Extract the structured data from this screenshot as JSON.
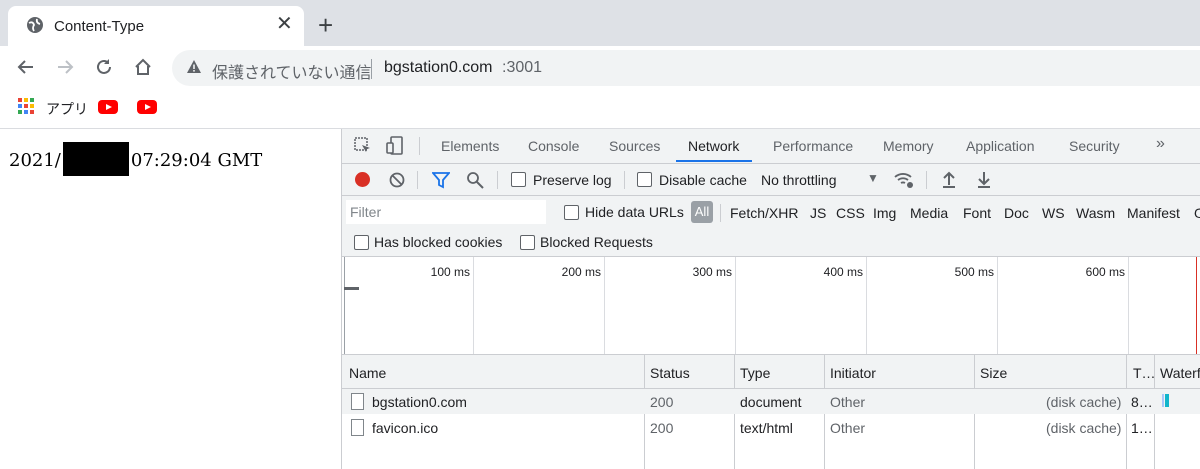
{
  "browser": {
    "tab_title": "Content-Type",
    "tab_close": "✕",
    "new_tab": "+",
    "security_text": "保護されていない通信",
    "url_host": "bgstation0.com",
    "url_port": ":3001",
    "bookmarks": {
      "apps_label": "アプリ"
    }
  },
  "page": {
    "date_prefix": "2021/",
    "time_suffix": "07:29:04 GMT"
  },
  "devtools": {
    "tabs": [
      "Elements",
      "Console",
      "Sources",
      "Network",
      "Performance",
      "Memory",
      "Application",
      "Security",
      "»"
    ],
    "active_tab": "Network",
    "toolbar": {
      "preserve_log": "Preserve log",
      "disable_cache": "Disable cache",
      "throttling": "No throttling"
    },
    "filter": {
      "placeholder": "Filter",
      "hide_data_urls": "Hide data URLs",
      "all": "All",
      "types": [
        "Fetch/XHR",
        "JS",
        "CSS",
        "Img",
        "Media",
        "Font",
        "Doc",
        "WS",
        "Wasm",
        "Manifest",
        "Ot"
      ],
      "has_blocked_cookies": "Has blocked cookies",
      "blocked_requests": "Blocked Requests"
    },
    "timeline_labels": [
      "100 ms",
      "200 ms",
      "300 ms",
      "400 ms",
      "500 ms",
      "600 ms"
    ],
    "table": {
      "headers": [
        "Name",
        "Status",
        "Type",
        "Initiator",
        "Size",
        "T…",
        "Waterf"
      ],
      "rows": [
        {
          "name": "bgstation0.com",
          "status": "200",
          "type": "document",
          "initiator": "Other",
          "size": "(disk cache)",
          "time": "8…"
        },
        {
          "name": "favicon.ico",
          "status": "200",
          "type": "text/html",
          "initiator": "Other",
          "size": "(disk cache)",
          "time": "1…"
        }
      ]
    }
  }
}
